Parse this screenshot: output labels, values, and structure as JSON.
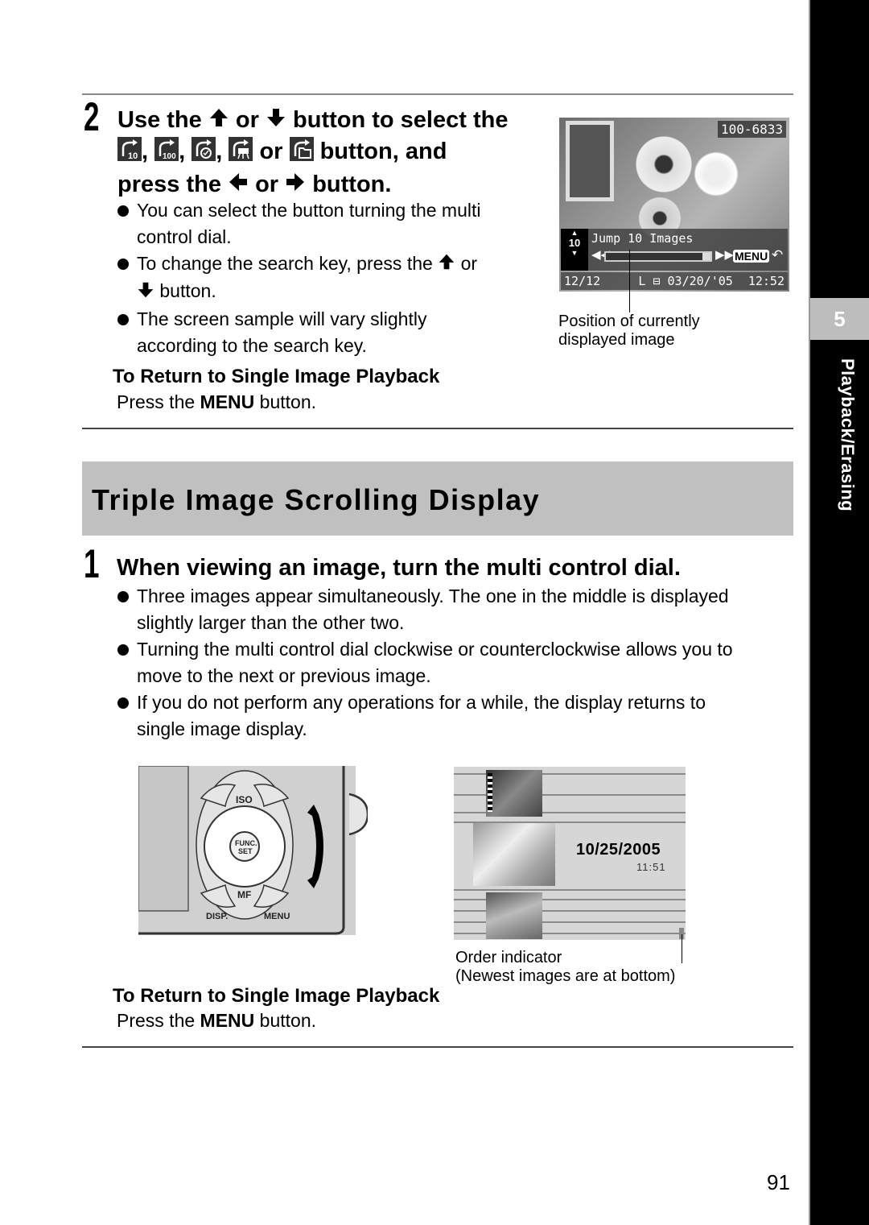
{
  "side_tab": {
    "chapter_number": "5",
    "chapter_title": "Playback/Erasing"
  },
  "step2": {
    "number": "2",
    "line1_a": "Use the",
    "line1_b": "or",
    "line1_c": "button to select the",
    "icons": [
      "jump-10-images-icon",
      "jump-100-images-icon",
      "jump-date-icon",
      "jump-movie-icon",
      "jump-folder-icon"
    ],
    "comma": ",",
    "line2_or": "or",
    "line2_end": "button, and",
    "line3_a": "press the",
    "line3_b": "or",
    "line3_c": "button.",
    "bullets": [
      {
        "text_a": "You can select the button turning the multi",
        "text_b": "control dial."
      },
      {
        "text_a": "To change the search key, press the",
        "text_or": "or",
        "text_b": "button."
      },
      {
        "text_a": "The screen sample will vary slightly",
        "text_b": "according to the search key."
      }
    ],
    "return_heading": "To Return to Single Image Playback",
    "return_pre": "Press the",
    "return_key": "MENU",
    "return_post": "button."
  },
  "lcd_screen": {
    "file_number": "100-6833",
    "search_label": "Jump 10 Images",
    "key_number": "10",
    "menu_label": "MENU",
    "image_counter": "12/12",
    "quality": "L",
    "date": "03/20/'05",
    "time": "12:52",
    "position_fraction": 1.0,
    "caption_line1": "Position of currently",
    "caption_line2": "displayed image"
  },
  "section": {
    "title": "Triple Image Scrolling Display"
  },
  "step1": {
    "number": "1",
    "heading": "When viewing an image, turn the multi control dial.",
    "bullets": [
      {
        "text_a": "Three images appear simultaneously. The one in the middle is displayed",
        "text_b": "slightly larger than the other two."
      },
      {
        "text_a": "Turning the multi control dial clockwise or counterclockwise allows you to",
        "text_b": "move to the next or previous image."
      },
      {
        "text_a": "If you do not perform any operations for a while, the display returns to",
        "text_b": "single image display."
      }
    ],
    "return_heading": "To Return to Single Image Playback",
    "return_pre": "Press the",
    "return_key": "MENU",
    "return_post": "button."
  },
  "camera_illustration": {
    "labels": {
      "iso": "ISO",
      "func": "FUNC.",
      "set": "SET",
      "mf": "MF",
      "disp": "DISP.",
      "menu": "MENU"
    }
  },
  "triple_display": {
    "date": "10/25/2005",
    "time": "11:51",
    "caption_line1": "Order indicator",
    "caption_line2": "(Newest images are at bottom)"
  },
  "page_number": "91"
}
